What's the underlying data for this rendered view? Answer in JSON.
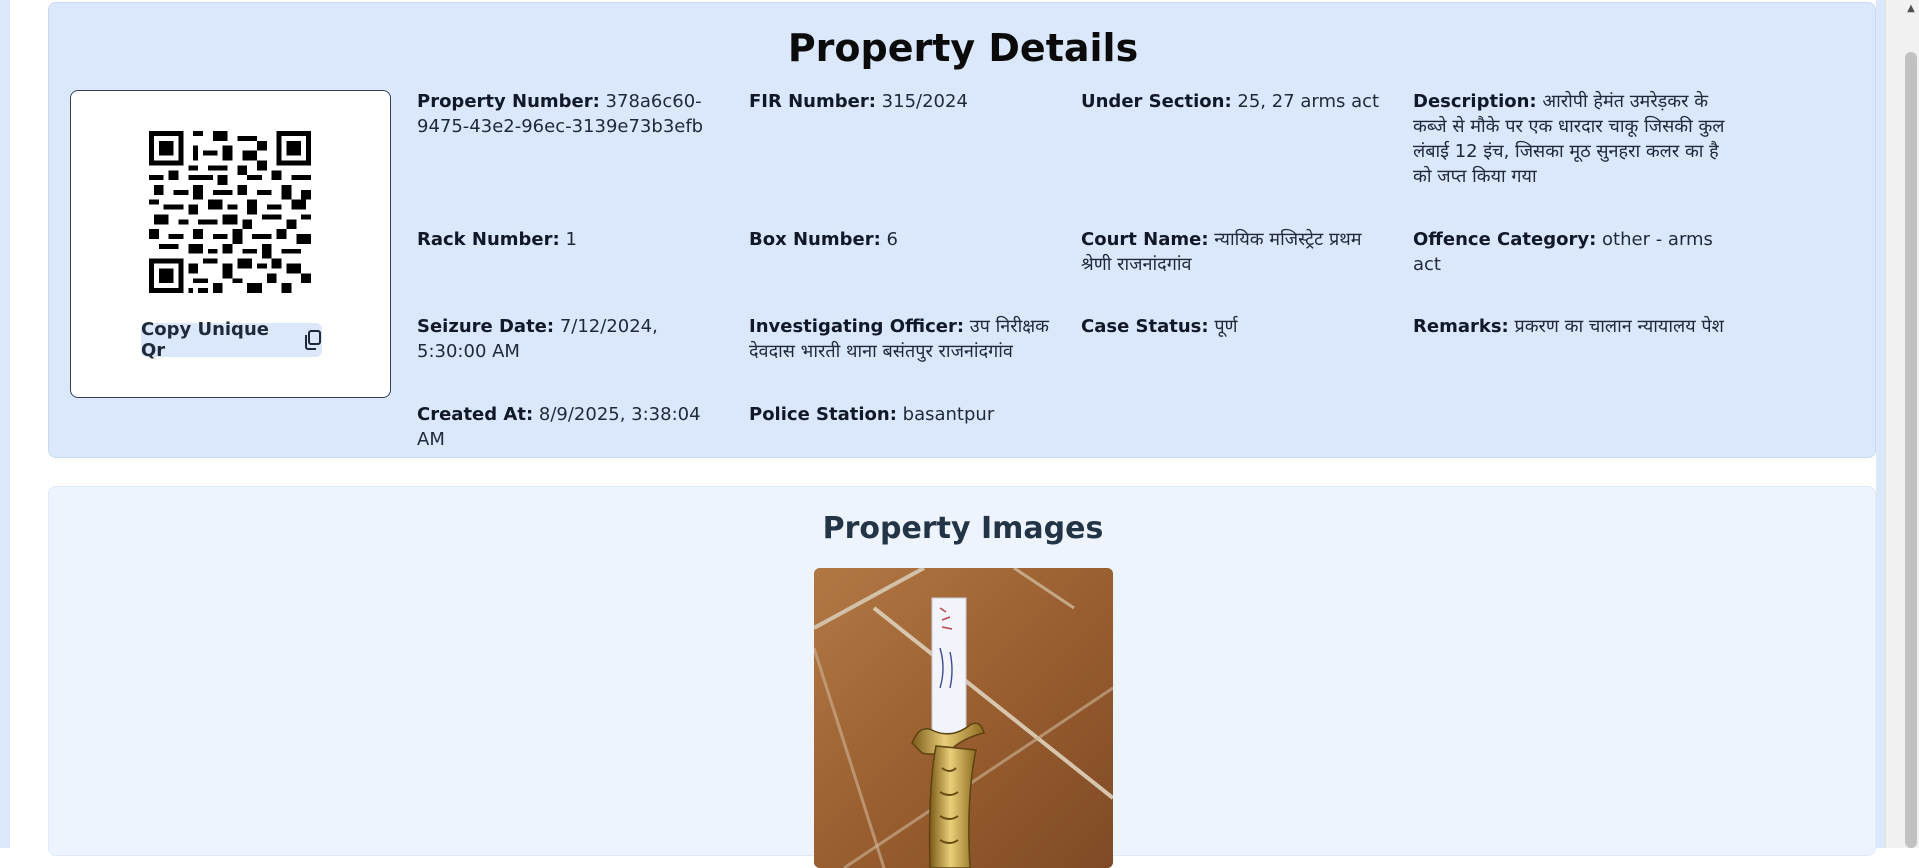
{
  "details": {
    "title": "Property Details",
    "copy_button_label": "Copy Unique Qr",
    "fields": {
      "property_number": {
        "label": "Property Number:",
        "value": "378a6c60-9475-43e2-96ec-3139e73b3efb"
      },
      "fir_number": {
        "label": "FIR Number:",
        "value": "315/2024"
      },
      "under_section": {
        "label": "Under Section:",
        "value": "25, 27 arms act"
      },
      "description": {
        "label": "Description:",
        "value": "आरोपी हेमंत उमरेड़कर के कब्जे से मौके पर एक धारदार चाकू जिसकी कुल लंबाई 12 इंच, जिसका मूठ सुनहरा कलर का है को जप्त किया गया"
      },
      "rack_number": {
        "label": "Rack Number:",
        "value": "1"
      },
      "box_number": {
        "label": "Box Number:",
        "value": "6"
      },
      "court_name": {
        "label": "Court Name:",
        "value": "न्यायिक मजिस्ट्रेट प्रथम श्रेणी राजनांदगांव"
      },
      "offence_category": {
        "label": "Offence Category:",
        "value": "other - arms act"
      },
      "seizure_date": {
        "label": "Seizure Date:",
        "value": "7/12/2024, 5:30:00 AM"
      },
      "investigating_officer": {
        "label": "Investigating Officer:",
        "value": "उप निरीक्षक देवदास भारती थाना बसंतपुर राजनांदगांव"
      },
      "case_status": {
        "label": "Case Status:",
        "value": "पूर्ण"
      },
      "remarks": {
        "label": "Remarks:",
        "value": "प्रकरण का चालान न्यायालय पेश"
      },
      "created_at": {
        "label": "Created At:",
        "value": "8/9/2025, 3:38:04 AM"
      },
      "police_station": {
        "label": "Police Station:",
        "value": "basantpur"
      }
    }
  },
  "images": {
    "title": "Property Images"
  },
  "icons": {
    "copy": "copy-icon",
    "qr": "qr-code",
    "scroll_up": "scroll-up-arrow-icon"
  },
  "colors": {
    "details_bg": "#dbe8fb",
    "images_bg": "#edf4fe",
    "button_bg": "#dbe8fb"
  }
}
